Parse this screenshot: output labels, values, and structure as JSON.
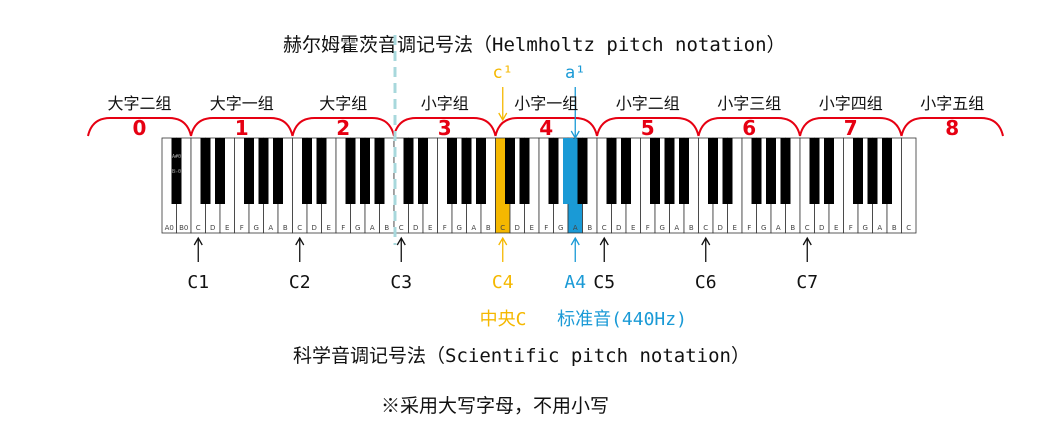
{
  "title_top": "赫尔姆霍茨音调记号法（Helmholtz pitch notation）",
  "title_bottom": "科学音调记号法（Scientific pitch notation）",
  "note": "※采用大写字母，不用小写",
  "groups": [
    {
      "name": "大字二组",
      "number": "0"
    },
    {
      "name": "大字一组",
      "number": "1"
    },
    {
      "name": "大字组",
      "number": "2"
    },
    {
      "name": "小字组",
      "number": "3"
    },
    {
      "name": "小字一组",
      "number": "4"
    },
    {
      "name": "小字二组",
      "number": "5"
    },
    {
      "name": "小字三组",
      "number": "6"
    },
    {
      "name": "小字四组",
      "number": "7"
    },
    {
      "name": "小字五组",
      "number": "8"
    }
  ],
  "helmholtz_marks": {
    "c1": "c¹",
    "a1": "a¹"
  },
  "white_keys": [
    "A0",
    "B0",
    "C",
    "D",
    "E",
    "F",
    "G",
    "A",
    "B",
    "C",
    "D",
    "E",
    "F",
    "G",
    "A",
    "B",
    "C",
    "D",
    "E",
    "F",
    "G",
    "A",
    "B",
    "C",
    "D",
    "E",
    "F",
    "G",
    "A",
    "B",
    "C",
    "D",
    "E",
    "F",
    "G",
    "A",
    "B",
    "C",
    "D",
    "E",
    "F",
    "G",
    "A",
    "B",
    "C",
    "D",
    "E",
    "F",
    "G",
    "A",
    "B",
    "C"
  ],
  "black_key_labels": [
    "A#0",
    "B♭0"
  ],
  "scientific_labels": [
    "C1",
    "C2",
    "C3",
    "C4",
    "A4",
    "C5",
    "C6",
    "C7"
  ],
  "middle_c_label": "中央C",
  "standard_pitch_label": "标准音(440Hz)",
  "colors": {
    "bracket": "#e60012",
    "middle_c": "#f5b800",
    "a4": "#1a9ad6",
    "divider": "#a8d8dc"
  }
}
